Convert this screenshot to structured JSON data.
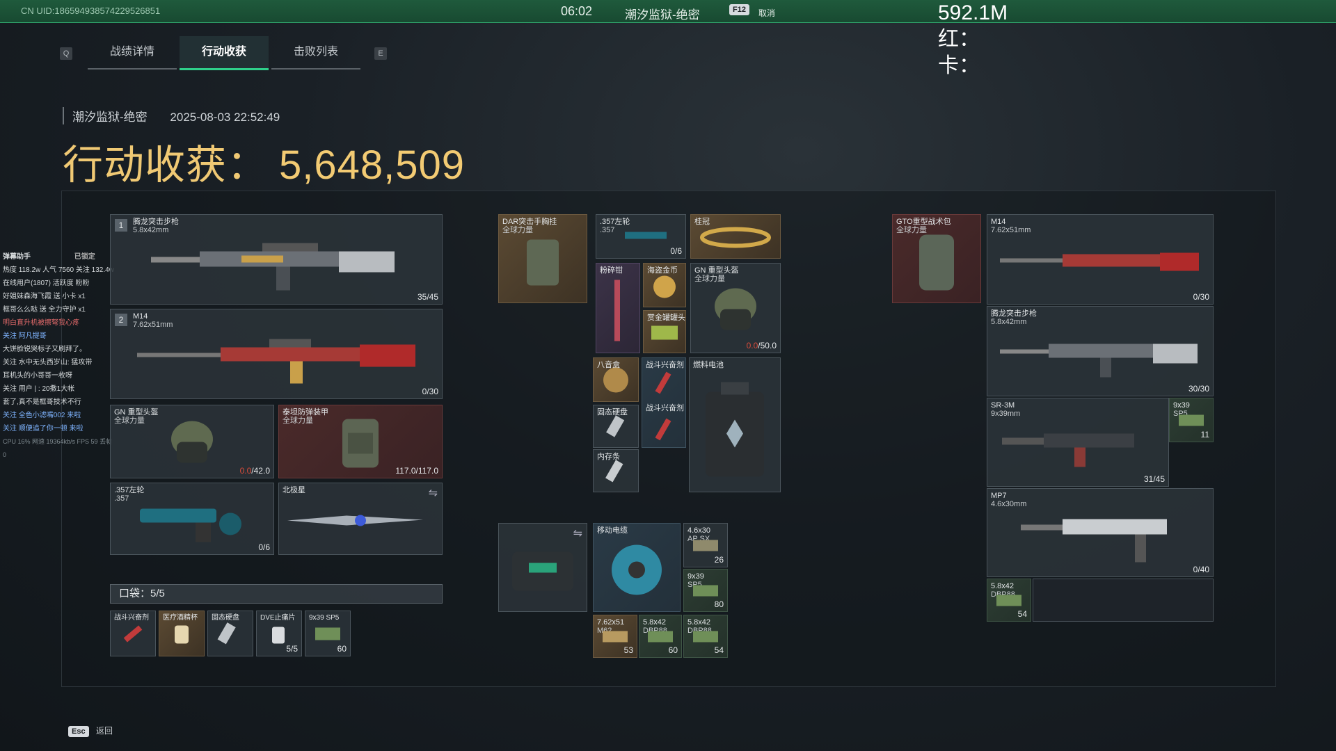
{
  "topbar": {
    "uid": "CN UID:18659493857422952685​1",
    "time": "06:02",
    "map": "潮汐监狱-绝密",
    "f12_key": "F12",
    "cancel_label": "取消"
  },
  "overlay": {
    "value": "592.1M",
    "line_red": "红：",
    "line_card": "卡："
  },
  "tabs": {
    "left_key": "Q",
    "right_key": "E",
    "items": [
      "战绩详情",
      "行动收获",
      "击败列表"
    ],
    "active": 1
  },
  "meta": {
    "map": "潮汐监狱-绝密",
    "datetime": "2025-08-03 22:52:49"
  },
  "loot": {
    "label": "行动收获：",
    "value": "5,648,509"
  },
  "chat": {
    "title": "弹幕助手",
    "locked": "已锁定",
    "stats": "热度 118.2w 人气 7560 关注 132.4w",
    "online": "在线用户(1807)  活跃度  粉粉",
    "lines": [
      "好姐妹森海飞霞 送 小卡 x1",
      "框哥么么哒 送 全力守护 x1",
      "明白直升机被擦弩我心疼",
      "关注 阿凡提哥",
      "大饼脸锐哭标子又刷拜了。",
      "关注 水中无头西岁山: 猛攻带",
      "耳机头的小哥哥一枚呀",
      "关注 用户 | : 20撒1大帐",
      "套了,真不是框哥技术不行",
      "关注 全色小滤嘴002 来啦",
      "关注 顺便追了你一顿 来啦"
    ],
    "perf": "CPU 16%  网速 19364kb/s FPS 59  丢帧 0"
  },
  "left_gear": {
    "primary": {
      "index": "1",
      "name": "腾龙突击步枪",
      "caliber": "5.8x42mm",
      "count": "35/45"
    },
    "secondary": {
      "index": "2",
      "name": "M14",
      "caliber": "7.62x51mm",
      "count": "0/30"
    },
    "helmet": {
      "name": "GN 重型头盔",
      "sub": "全球力量",
      "damaged": "0.0",
      "count": "/42.0"
    },
    "armor": {
      "name": "泰坦防弹装甲",
      "sub": "全球力量",
      "count": "117.0/117.0"
    },
    "pistol": {
      "name": ".357左轮",
      ".sub": "",
      "sub": ".357",
      "count": "0/6"
    },
    "melee": {
      "name": "北极星"
    }
  },
  "pouch": {
    "label": "口袋：",
    "value": "5/5",
    "items": [
      {
        "name": "战斗兴奋剂",
        "count": ""
      },
      {
        "name": "医疗酒精杯",
        "count": ""
      },
      {
        "name": "固态硬盘",
        "count": ""
      },
      {
        "name": "DVE止痛片",
        "count": "5/5"
      },
      {
        "name": "9x39 SP5",
        "count": "60"
      }
    ]
  },
  "mid": {
    "rig": {
      "name": "DAR突击手胸挂",
      "sub": "全球力量"
    },
    "revolver": {
      "name": ".357左轮",
      "sub": ".357",
      "count": "0/6"
    },
    "crown": {
      "name": "桂冠"
    },
    "pliers": {
      "name": "粉碎钳"
    },
    "coin": {
      "name": "海盗金币"
    },
    "cans": {
      "name": "赏金罐罐头"
    },
    "helmet2": {
      "name": "GN 重型头盔",
      "sub": "全球力量",
      "damaged": "0.0",
      "count": "/50.0"
    },
    "bagua": {
      "name": "八音盒"
    },
    "stim1": {
      "name": "战斗兴奋剂"
    },
    "battery": {
      "name": "燃料电池"
    },
    "ssd": {
      "name": "固态硬盘"
    },
    "stim2": {
      "name": "战斗兴奋剂"
    },
    "ram": {
      "name": "内存条"
    },
    "case": {
      "name": ""
    },
    "cable": {
      "name": "移动电缆"
    },
    "ammo1": {
      "name": "4.6x30",
      "sub": "AP SX",
      "count": "26"
    },
    "ammo2": {
      "name": "9x39",
      "sub": "SP5",
      "count": "80"
    },
    "ammo3": {
      "name": "7.62x51",
      "sub": "M62",
      "count": "53"
    },
    "ammo4": {
      "name": "5.8x42",
      "sub": "DBP88",
      "count": "60"
    },
    "ammo5": {
      "name": "5.8x42",
      "sub": "DBP88",
      "count": "54"
    }
  },
  "right": {
    "backpack": {
      "name": "GTO重型战术包",
      "sub": "全球力量"
    },
    "m14": {
      "name": "M14",
      "sub": "7.62x51mm",
      "count": "0/30"
    },
    "tenglong": {
      "name": "腾龙突击步枪",
      "sub": "5.8x42mm",
      "count": "30/30"
    },
    "sr3m": {
      "name": "SR-3M",
      "sub": "9x39mm",
      "count": "31/45"
    },
    "sr3m_ammo": {
      "name": "9x39",
      "sub": "SP5",
      "count": "11"
    },
    "mp7": {
      "name": "MP7",
      "sub": "4.6x30mm",
      "count": "0/40"
    },
    "ammo58": {
      "name": "5.8x42",
      "sub": "DBP88",
      "count": "54"
    }
  },
  "footer": {
    "esc_key": "Esc",
    "back_label": "返回"
  },
  "colors": {
    "accent": "#2fd08a",
    "gold": "#f3cb73",
    "topbar": "#1f5a3c",
    "damage": "#d94b3a"
  }
}
